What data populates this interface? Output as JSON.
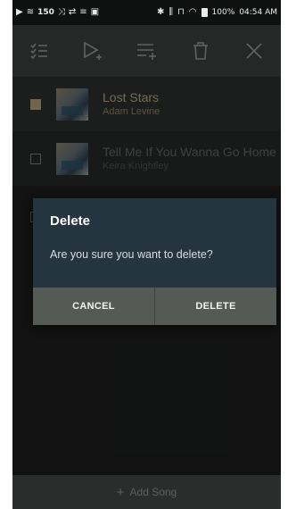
{
  "statusbar": {
    "signal_text": "150",
    "battery_percent": "100%",
    "time": "04:54 AM"
  },
  "toolbar": {
    "icons": [
      "select-all-icon",
      "play-next-icon",
      "add-to-playlist-icon",
      "delete-icon",
      "close-icon"
    ]
  },
  "songs": [
    {
      "title": "Lost Stars",
      "artist": "Adam Levine",
      "checked": true
    },
    {
      "title": "Tell Me If You Wanna Go Home",
      "artist": "Keira Knightley",
      "checked": false
    }
  ],
  "dialog": {
    "title": "Delete",
    "message": "Are you sure you want to delete?",
    "cancel_label": "CANCEL",
    "delete_label": "DELETE"
  },
  "footer": {
    "add_song_label": "Add Song"
  },
  "colors": {
    "accent": "#b7a175",
    "dialog_bg": "#243540",
    "dialog_buttons": "#555a57"
  }
}
